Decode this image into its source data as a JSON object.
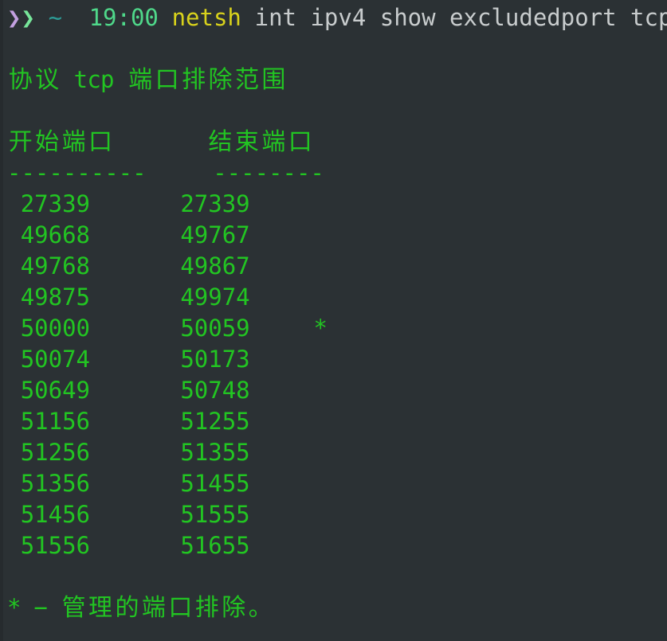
{
  "terminal": {
    "background_color": "#2b3134",
    "output_color": "#22c522",
    "font_size_px": 29,
    "line_height_px": 39,
    "columns": 50,
    "prompt": {
      "chevron_left": "❯",
      "chevron_left_color": "#c3a0e0",
      "chevron_right": "❯",
      "chevron_right_color": "#77e69a",
      "cwd": "~",
      "cwd_color": "#2d9b95",
      "time": "19:00",
      "time_color": "#4fd88a",
      "command_name": "netsh",
      "command_name_color": "#d8d21c",
      "command_args": "int ipv4 show excludedport tcp",
      "command_args_color": "#c8cccd",
      "full_command": "netsh int ipv4 show excludedport tcp"
    },
    "output": {
      "title": "协议 tcp 端口排除范围",
      "title_protocol": "tcp",
      "columns": [
        {
          "header": "开始端口",
          "rule": "----------"
        },
        {
          "header": "结束端口",
          "rule": "--------"
        }
      ],
      "rows": [
        {
          "start": "27339",
          "end": "27339",
          "flag": ""
        },
        {
          "start": "49668",
          "end": "49767",
          "flag": ""
        },
        {
          "start": "49768",
          "end": "49867",
          "flag": ""
        },
        {
          "start": "49875",
          "end": "49974",
          "flag": ""
        },
        {
          "start": "50000",
          "end": "50059",
          "flag": "*"
        },
        {
          "start": "50074",
          "end": "50173",
          "flag": ""
        },
        {
          "start": "50649",
          "end": "50748",
          "flag": ""
        },
        {
          "start": "51156",
          "end": "51255",
          "flag": ""
        },
        {
          "start": "51256",
          "end": "51355",
          "flag": ""
        },
        {
          "start": "51356",
          "end": "51455",
          "flag": ""
        },
        {
          "start": "51456",
          "end": "51555",
          "flag": ""
        },
        {
          "start": "51556",
          "end": "51655",
          "flag": ""
        }
      ],
      "footnote_marker": "*",
      "footnote_dash": "−",
      "footnote_text": "管理的端口排除。",
      "footnote_full": "* − 管理的端口排除。"
    }
  }
}
